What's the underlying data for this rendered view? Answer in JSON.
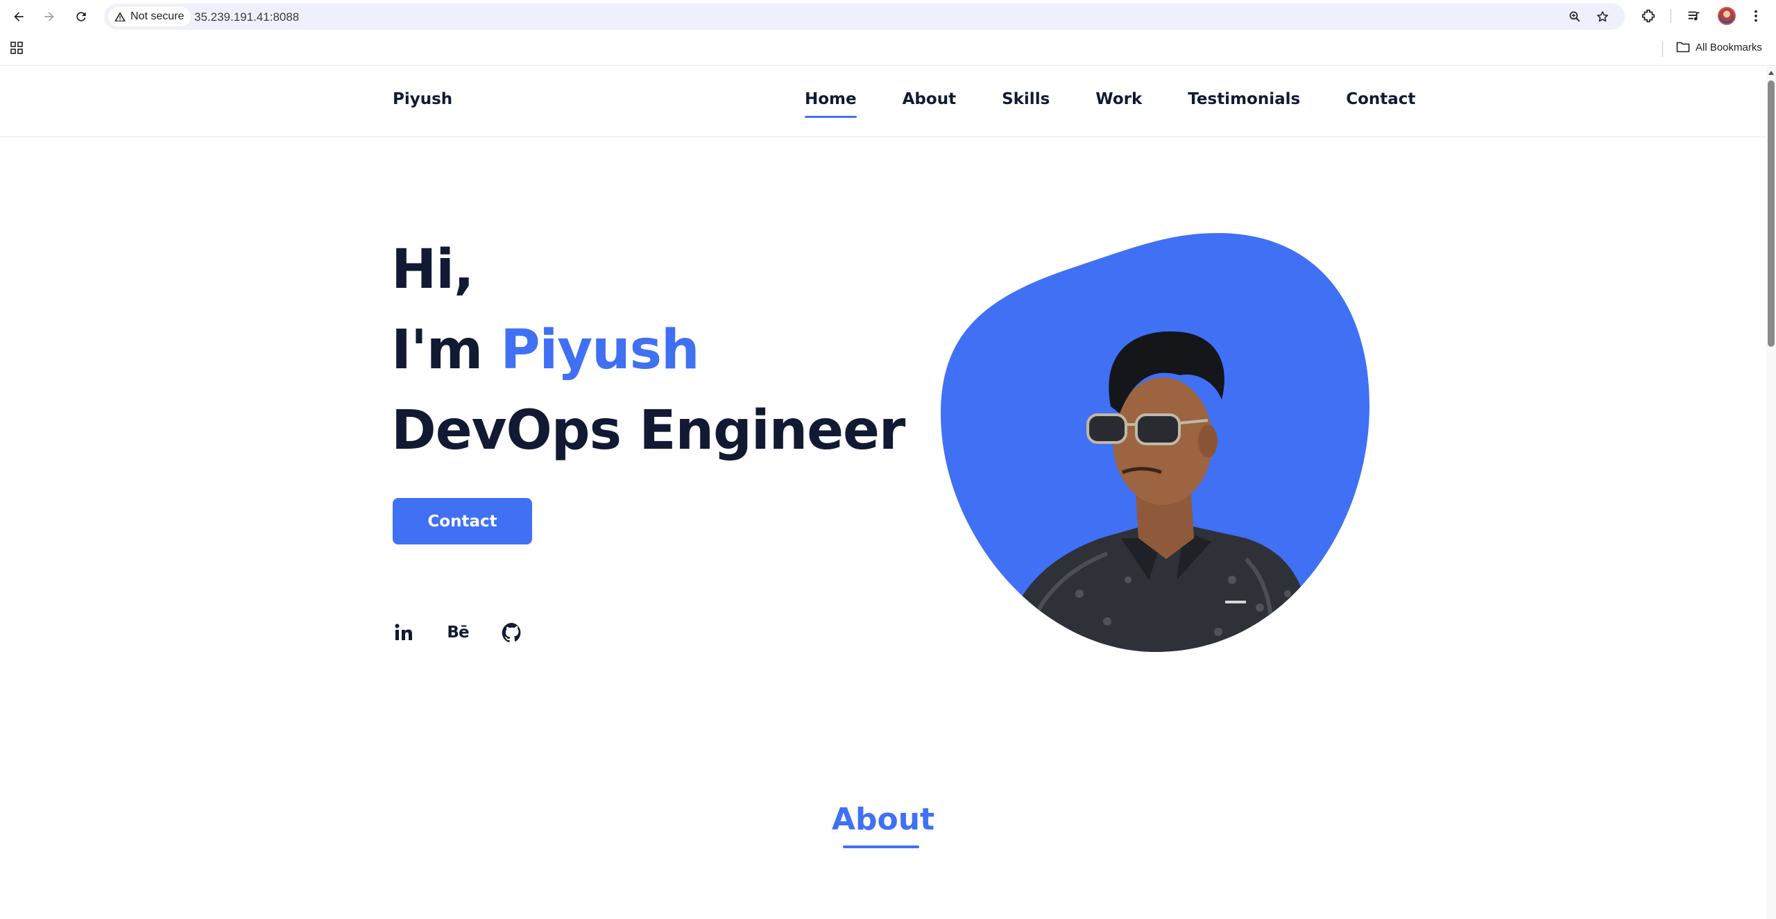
{
  "browser": {
    "security_label": "Not secure",
    "url": "35.239.191.41:8088",
    "bookmarks_label": "All Bookmarks"
  },
  "site": {
    "logo": "Piyush",
    "nav": [
      {
        "label": "Home",
        "active": true
      },
      {
        "label": "About"
      },
      {
        "label": "Skills"
      },
      {
        "label": "Work"
      },
      {
        "label": "Testimonials"
      },
      {
        "label": "Contact"
      }
    ],
    "hero": {
      "line1": "Hi,",
      "line2_prefix": "I'm ",
      "line2_name": "Piyush",
      "line3": "DevOps Engineer",
      "cta": "Contact"
    },
    "socials": [
      {
        "icon": "linkedin-icon",
        "label": "in"
      },
      {
        "icon": "behance-icon",
        "label": "Bē"
      },
      {
        "icon": "github-icon"
      }
    ],
    "about_heading": "About"
  },
  "colors": {
    "accent": "#4070f4",
    "text_dark": "#121a33",
    "omnibox_bg": "#eef1fb"
  }
}
